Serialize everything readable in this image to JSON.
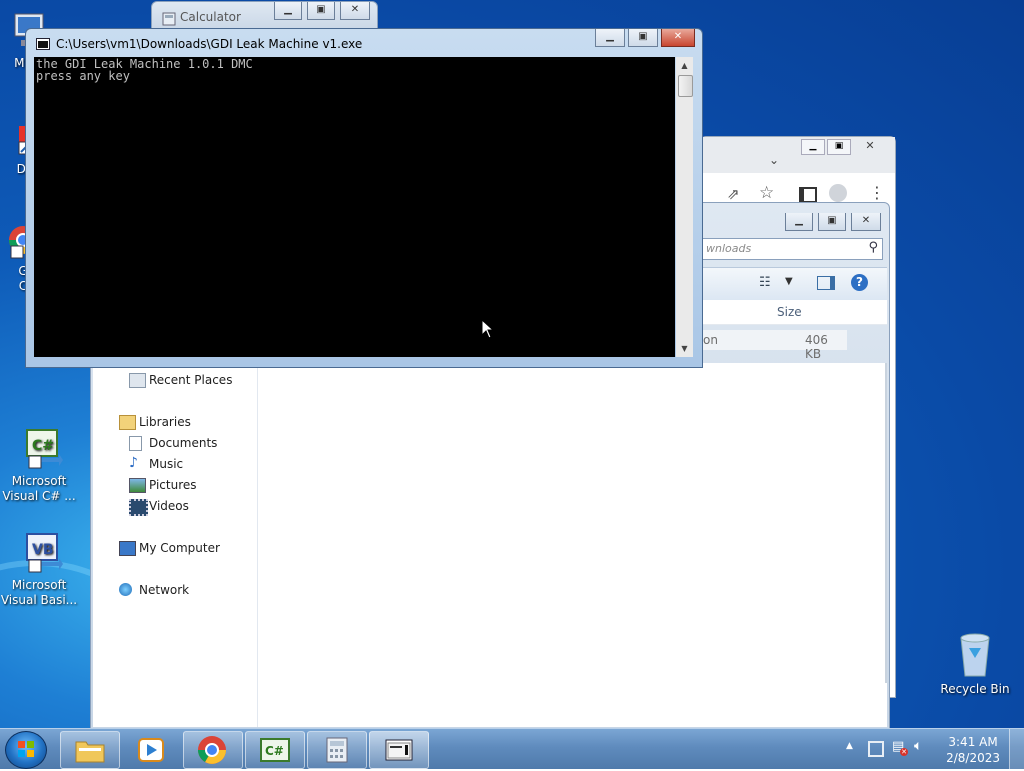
{
  "desktop": {
    "icons": [
      {
        "label": "My C"
      },
      {
        "label": "Data"
      },
      {
        "label": "G\nC"
      },
      {
        "label": "Microsoft\nVisual C# ..."
      },
      {
        "label": "Microsoft\nVisual Basi..."
      },
      {
        "label": "Recycle Bin"
      }
    ]
  },
  "calculator": {
    "title": "Calculator"
  },
  "console": {
    "title": "C:\\Users\\vm1\\Downloads\\GDI Leak Machine v1.exe",
    "lines": "the GDI Leak Machine 1.0.1 DMC\npress any key"
  },
  "explorer": {
    "search_placeholder": "wnloads",
    "column_size": "Size",
    "file_name_fragment": "on",
    "file_size": "406 KB",
    "nav": {
      "recent": "Recent Places",
      "libraries": "Libraries",
      "documents": "Documents",
      "music": "Music",
      "pictures": "Pictures",
      "videos": "Videos",
      "computer": "My Computer",
      "network": "Network"
    }
  },
  "taskbar": {
    "time": "3:41 AM",
    "date": "2/8/2023",
    "items": [
      "explorer-folder",
      "media-player",
      "chrome",
      "visual-csharp",
      "calculator",
      "console"
    ]
  },
  "colors": {
    "accent": "#1e7fd4",
    "console_bg": "#000000",
    "console_fg": "#c0c0c0"
  }
}
